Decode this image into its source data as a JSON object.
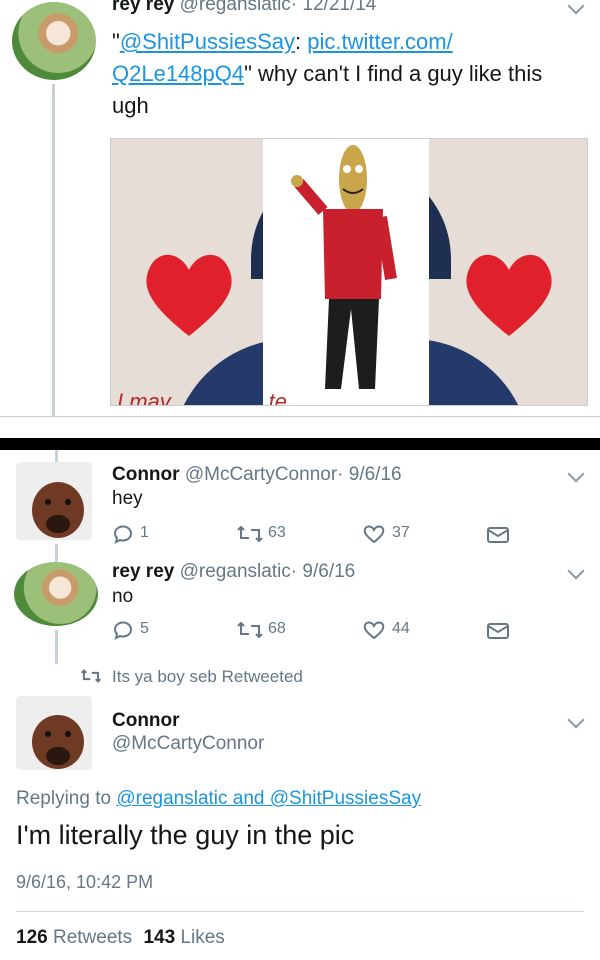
{
  "tweet1": {
    "name": "rey rey",
    "handle": "@reganslatic",
    "date": "· 12/21/14",
    "text_open_quote": "\"",
    "text_mention": "@ShitPussiesSay",
    "text_colon": ": ",
    "text_link": "pic.twitter.com/ Q2Le148pQ4",
    "text_tail": "\" why can't I find a guy like this ugh",
    "image_caption": "I may ... ... ... ...te"
  },
  "reply1": {
    "name": "Connor",
    "handle": "@McCartyConnor",
    "date": "· 9/6/16",
    "text": "hey",
    "replies": "1",
    "retweets": "63",
    "likes": "37"
  },
  "reply2": {
    "name": "rey rey",
    "handle": "@reganslatic",
    "date": "· 9/6/16",
    "text": "no",
    "replies": "5",
    "retweets": "68",
    "likes": "44"
  },
  "retweet_notice": "Its ya boy seb Retweeted",
  "main": {
    "name": "Connor",
    "handle": "@McCartyConnor",
    "replying_prefix": "Replying to ",
    "replying_to": "@reganslatic and @ShitPussiesSay",
    "text": "I'm literally the guy in the pic",
    "timestamp": "9/6/16, 10:42 PM",
    "retweets_count": "126",
    "retweets_label": "Retweets",
    "likes_count": "143",
    "likes_label": "Likes"
  },
  "colors": {
    "accent": "#1b95e0",
    "heart": "#e0212b",
    "jacket": "#c8202c"
  }
}
